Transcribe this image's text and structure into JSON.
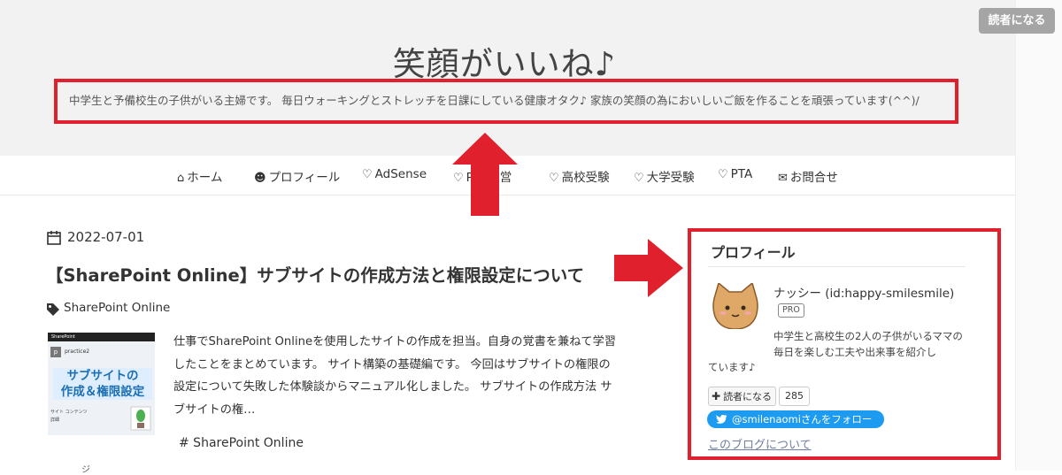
{
  "header": {
    "site_title": "笑顔がいいね♪",
    "description": "中学生と予備校生の子供がいる主婦です。 毎日ウォーキングとストレッチを日課にしている健康オタク♪ 家族の笑顔の為においしいご飯を作ることを頑張っています(^^)/",
    "subscribe_label": "読者になる"
  },
  "nav": {
    "items": [
      {
        "icon": "home-icon",
        "label": "ホーム"
      },
      {
        "icon": "smile-icon",
        "label": "プロフィール"
      },
      {
        "icon": "heart-icon",
        "label": "AdSense"
      },
      {
        "icon": "heart-icon",
        "label": "PTA運営"
      },
      {
        "icon": "heart-icon",
        "label": "高校受験"
      },
      {
        "icon": "heart-icon",
        "label": "大学受験"
      },
      {
        "icon": "heart-icon",
        "label": "PTA"
      },
      {
        "icon": "mail-icon",
        "label": "お問合せ"
      }
    ]
  },
  "post": {
    "date": "2022-07-01",
    "title": "【SharePoint Online】サブサイトの作成方法と権限設定について",
    "category": "SharePoint Online",
    "thumbnail": {
      "bar_text": "SharePoint",
      "p_letter": "p",
      "site_label": "practice2",
      "headline_1": "サブサイトの",
      "headline_2": "作成＆権限設定",
      "small_1": "サイト コンテンツ",
      "small_2": "詳細"
    },
    "excerpt": "仕事でSharePoint Onlineを使用したサイトの作成を担当。自身の覚書を兼ねて学習したことをまとめています。 サイト構築の基礎編です。 今回はサブサイトの権限の設定について失敗した体験談からマニュアル化しました。 サブサイトの作成方法 サブサイトの権…",
    "tag": "# SharePoint Online"
  },
  "sidebar": {
    "title": "プロフィール",
    "name": "ナッシー (id:happy-smilesmile)",
    "pro_badge": "PRO",
    "desc_line1": "中学生と高校生の2人の子供がいるママの毎日を楽しむ工夫や出来事を紹介し",
    "desc_line2": "ています♪",
    "reader_label": "読者になる",
    "reader_count": "285",
    "follow_label": "@smilenaomiさんをフォロー",
    "about_link": "このブログについて"
  },
  "footer": {
    "partial": "ジ"
  },
  "colors": {
    "highlight": "#e0212d",
    "twitter": "#1d9bf0",
    "header_bg": "#f2f2f2"
  }
}
